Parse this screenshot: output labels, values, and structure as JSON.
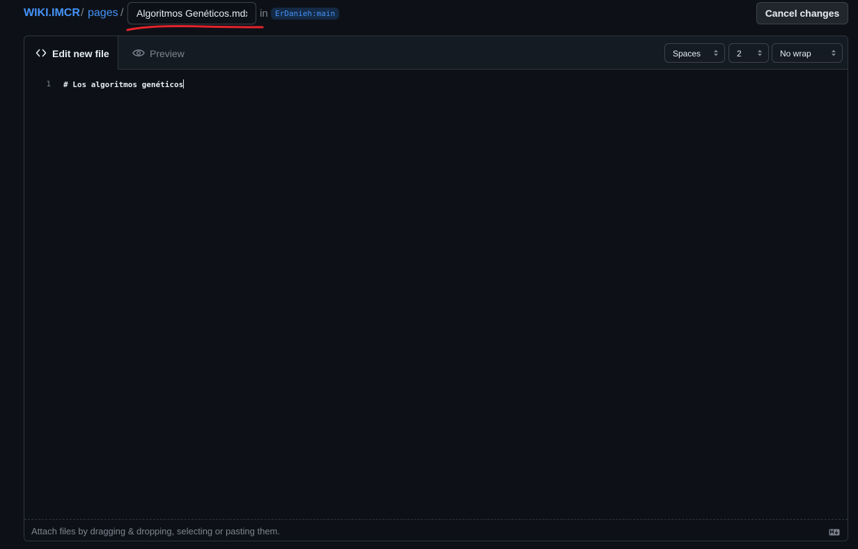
{
  "breadcrumb": {
    "repo": "WIKI.IMCR",
    "separator": "/",
    "folder": "pages"
  },
  "filename": {
    "value": "Algoritmos Genéticos.mdx"
  },
  "branch": {
    "prefix": "in",
    "name": "ErDanieh:main"
  },
  "actions": {
    "cancel_label": "Cancel changes"
  },
  "tabs": {
    "edit_label": "Edit new file",
    "preview_label": "Preview"
  },
  "settings": {
    "indent_mode": "Spaces",
    "indent_size": "2",
    "wrap_mode": "No wrap"
  },
  "editor": {
    "lines": [
      {
        "number": "1",
        "text": "# Los algoritmos genéticos"
      }
    ]
  },
  "footer": {
    "attach_hint": "Attach files by dragging & dropping, selecting or pasting them."
  },
  "colors": {
    "background": "#0d1117",
    "accent": "#4493f8",
    "annotation_underline": "#e5242b"
  }
}
